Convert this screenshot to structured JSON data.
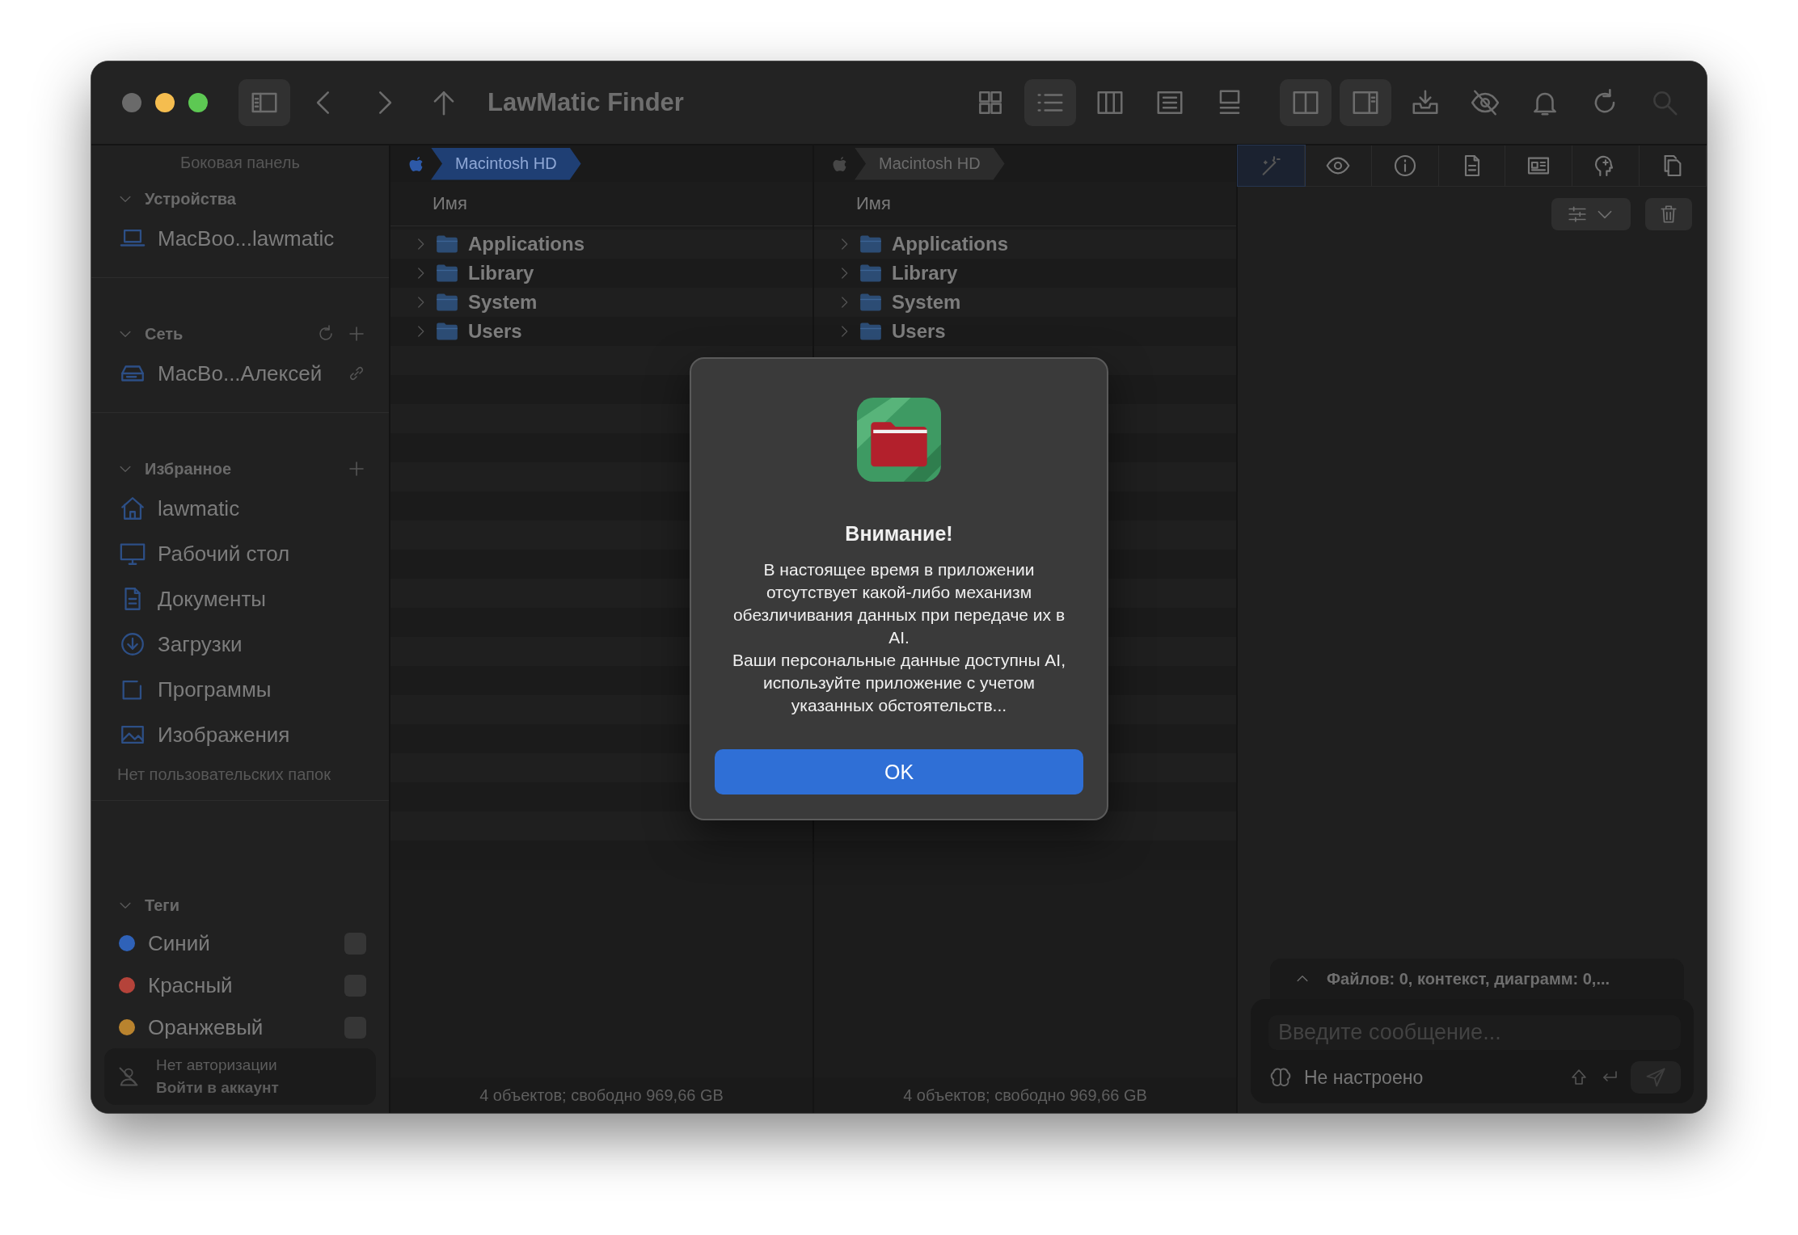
{
  "window": {
    "title": "LawMatic Finder"
  },
  "toolbar": {
    "sidebar_toggle": {
      "on": true
    },
    "view_modes": [
      {
        "selected": false
      },
      {
        "selected": true
      },
      {
        "selected": false
      },
      {
        "selected": false
      },
      {
        "selected": false
      }
    ],
    "panes": [
      {
        "on": true
      },
      {
        "on": true
      }
    ]
  },
  "sidebar": {
    "title": "Боковая панель",
    "sections": [
      {
        "kind": "devices",
        "title": "Устройства",
        "expanded": true,
        "items": [
          {
            "label": "MacBoo...lawmatic"
          }
        ]
      },
      {
        "kind": "network",
        "title": "Сеть",
        "expanded": true,
        "items": [
          {
            "label": "MacBo...Алексей"
          }
        ]
      },
      {
        "kind": "favorites",
        "title": "Избранное",
        "expanded": true,
        "items": [
          {
            "label": "lawmatic"
          },
          {
            "label": "Рабочий стол"
          },
          {
            "label": "Документы"
          },
          {
            "label": "Загрузки"
          },
          {
            "label": "Программы"
          },
          {
            "label": "Изображения"
          }
        ],
        "note": "Нет пользовательских папок"
      },
      {
        "kind": "tags",
        "title": "Теги",
        "expanded": true,
        "items": [
          {
            "label": "Синий",
            "color": "#2f62b8",
            "checked": false
          },
          {
            "label": "Красный",
            "color": "#b5433a",
            "checked": false
          },
          {
            "label": "Оранжевый",
            "color": "#b9832e",
            "checked": false
          }
        ]
      }
    ],
    "account": {
      "status": "Нет авторизации",
      "action": "Войти в аккаунт"
    }
  },
  "panes": [
    {
      "path": [
        {
          "label": "Macintosh HD",
          "selected": true
        }
      ],
      "header": "Имя",
      "rows": [
        {
          "name": "Applications",
          "expanded": false
        },
        {
          "name": "Library",
          "expanded": false
        },
        {
          "name": "System",
          "expanded": false
        },
        {
          "name": "Users",
          "expanded": false
        }
      ],
      "status": "4 объектов; свободно 969,66 GB"
    },
    {
      "path": [
        {
          "label": "Macintosh HD",
          "selected": false
        }
      ],
      "header": "Имя",
      "rows": [
        {
          "name": "Applications",
          "expanded": false
        },
        {
          "name": "Library",
          "expanded": false
        },
        {
          "name": "System",
          "expanded": false
        },
        {
          "name": "Users",
          "expanded": false
        }
      ],
      "status": "4 объектов; свободно 969,66 GB"
    }
  ],
  "inspector": {
    "tabs": [
      {
        "selected": true
      },
      {
        "selected": false
      },
      {
        "selected": false
      },
      {
        "selected": false
      },
      {
        "selected": false
      },
      {
        "selected": false
      },
      {
        "selected": false
      }
    ],
    "chat": {
      "summary": "Файлов: 0, контекст, диаграмм: 0,...",
      "summary_expanded": false,
      "placeholder": "Введите сообщение...",
      "model": "Не настроено"
    }
  },
  "dialog": {
    "title": "Внимание!",
    "message": [
      "В настоящее время в приложении отсутствует какой-либо механизм обезличивания данных при передаче их в AI.",
      "Ваши персональные данные доступны AI, используйте приложение с учетом указанных обстоятельств..."
    ],
    "button": "OK"
  }
}
